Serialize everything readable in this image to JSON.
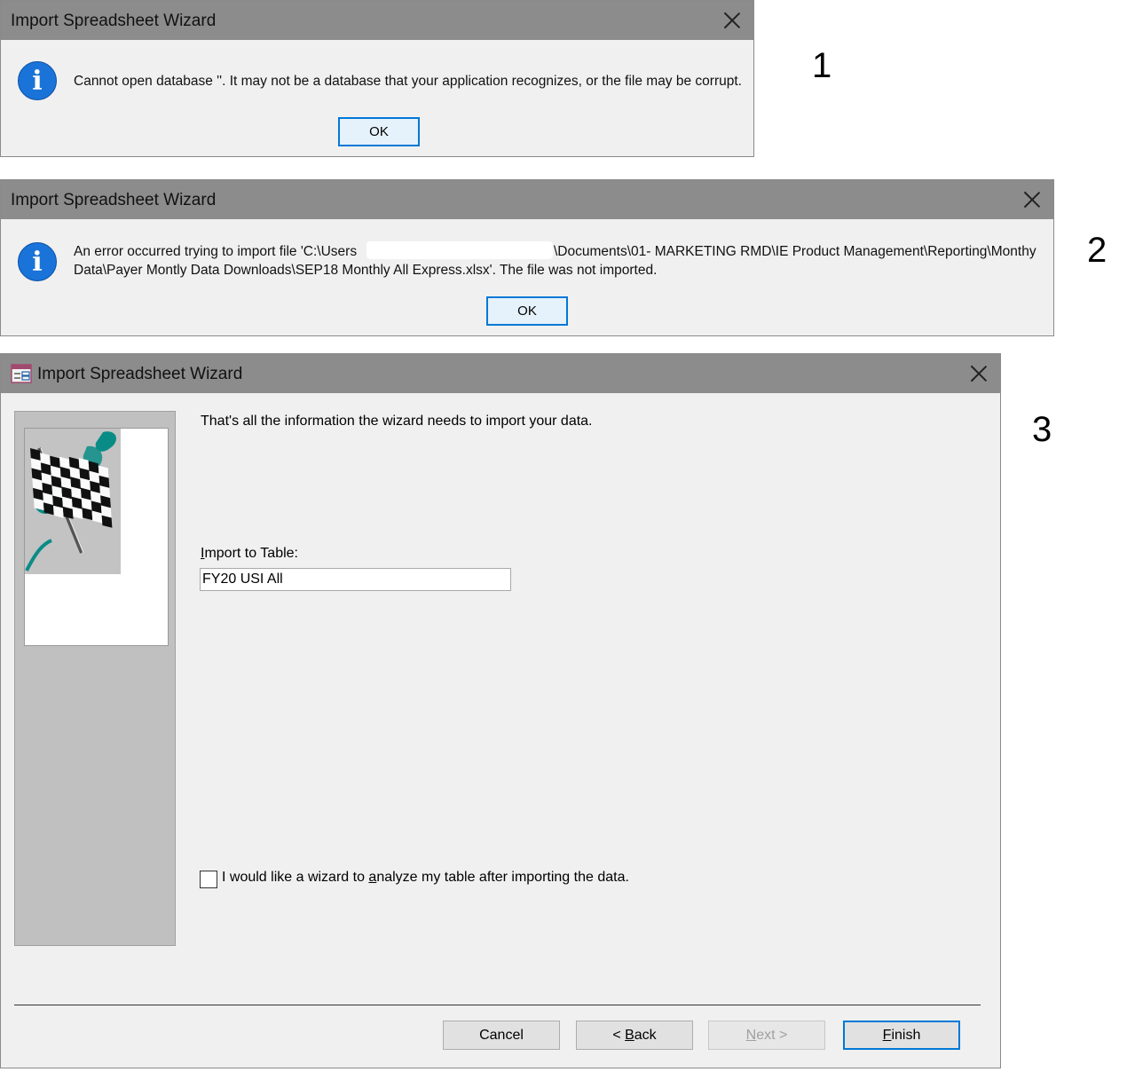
{
  "dialog1": {
    "title": "Import Spreadsheet Wizard",
    "message": "Cannot open database ''. It may not be a database that your application recognizes, or the file may be corrupt.",
    "ok_label": "OK",
    "marker": "1"
  },
  "dialog2": {
    "title": "Import Spreadsheet Wizard",
    "message_line1_a": "An error occurred trying to import file 'C:\\Users",
    "message_line1_b": "\\Documents\\01- MARKETING RMD\\IE Product Management\\Reporting\\Monthy",
    "message_line2": "Data\\Payer Montly Data Downloads\\SEP18 Monthly All Express.xlsx'. The file was not imported.",
    "ok_label": "OK",
    "marker": "2"
  },
  "wizard": {
    "title": "Import Spreadsheet Wizard",
    "intro": "That's all the information the wizard needs to import your data.",
    "import_label_accel": "I",
    "import_label_rest": "mport to Table:",
    "table_name": "FY20 USI All",
    "checkbox_label_a": "I would like a wizard to ",
    "checkbox_label_accel": "a",
    "checkbox_label_b": "nalyze my table after importing the data.",
    "checkbox_checked": false,
    "buttons": {
      "cancel": "Cancel",
      "back_pre": "< ",
      "back_accel": "B",
      "back_rest": "ack",
      "next_accel": "N",
      "next_rest": "ext >",
      "finish_accel": "F",
      "finish_rest": "inish"
    },
    "marker": "3"
  },
  "colors": {
    "titlebar": "#8c8c8c",
    "dialog_bg": "#f0f0f0",
    "accent": "#0078d7",
    "teal": "#0a8c86"
  }
}
